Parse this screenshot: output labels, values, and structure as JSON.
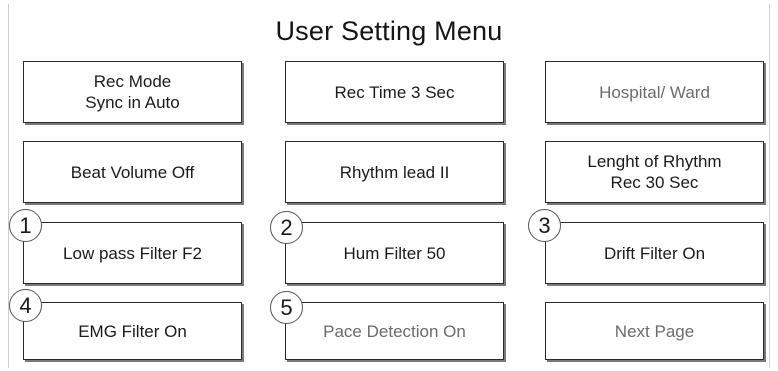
{
  "menu": {
    "title": "User Setting Menu",
    "buttons": [
      {
        "label": "Rec Mode\nSync in Auto"
      },
      {
        "label": "Rec Time 3 Sec"
      },
      {
        "label": "Hospital/ Ward"
      },
      {
        "label": "Beat Volume Off"
      },
      {
        "label": "Rhythm lead II"
      },
      {
        "label": "Lenght of Rhythm\nRec 30 Sec"
      },
      {
        "label": "Low pass Filter F2"
      },
      {
        "label": "Hum Filter 50"
      },
      {
        "label": "Drift Filter On"
      },
      {
        "label": "EMG Filter On"
      },
      {
        "label": "Pace Detection On"
      },
      {
        "label": "Next Page"
      }
    ]
  },
  "callouts": [
    "1",
    "2",
    "3",
    "4",
    "5"
  ]
}
